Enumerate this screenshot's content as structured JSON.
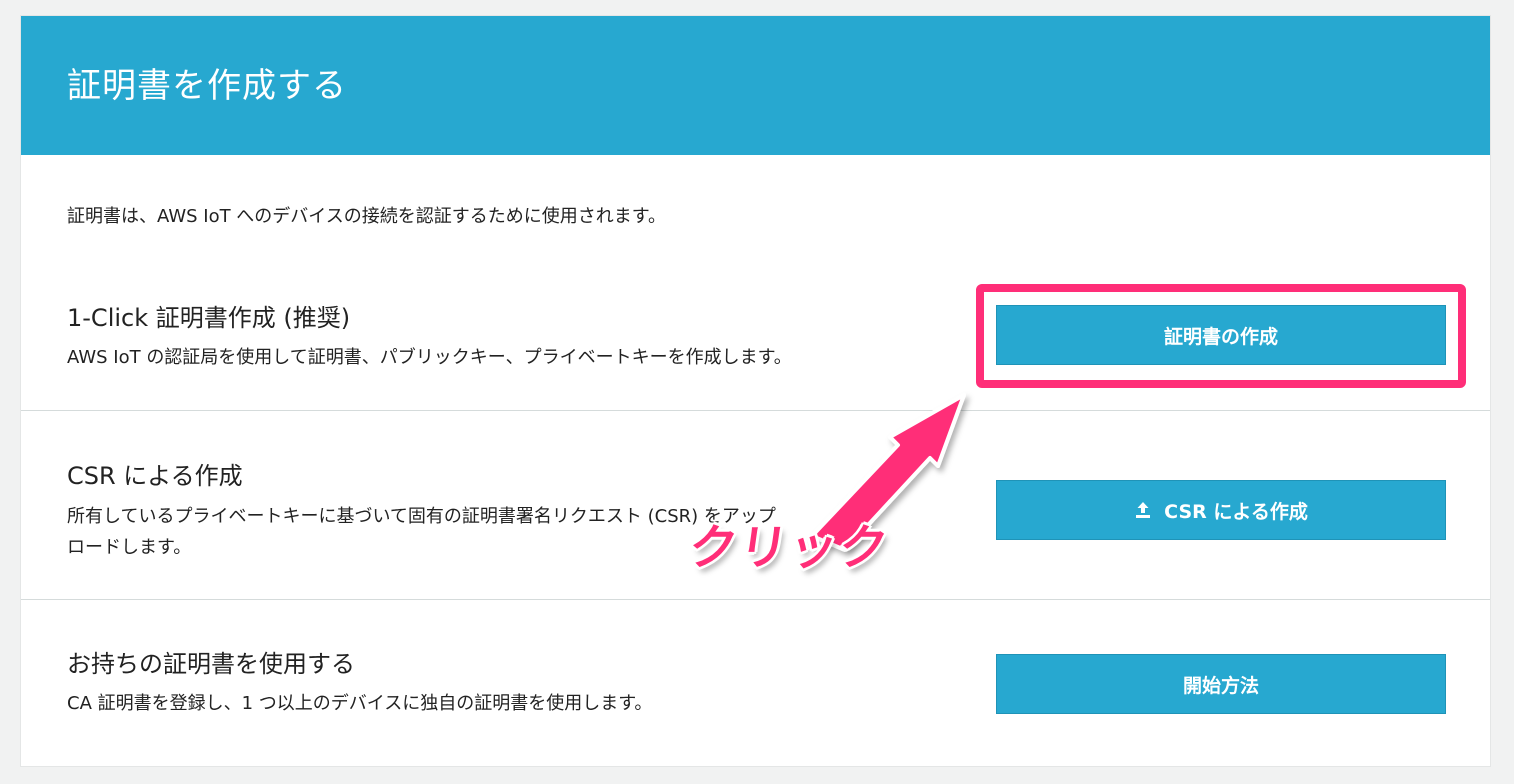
{
  "header": {
    "title": "証明書を作成する"
  },
  "intro": "証明書は、AWS IoT へのデバイスの接続を認証するために使用されます。",
  "sections": [
    {
      "title": "1-Click 証明書作成 (推奨)",
      "description": "AWS IoT の認証局を使用して証明書、パブリックキー、プライベートキーを作成します。",
      "button_label": "証明書の作成"
    },
    {
      "title": "CSR による作成",
      "description_line1": "所有しているプライベートキーに基づいて固有の証明書署名リクエスト (CSR) をアップ",
      "description_line2": "ロードします。",
      "button_label": "CSR による作成",
      "button_icon": "upload-icon"
    },
    {
      "title": "お持ちの証明書を使用する",
      "description": "CA 証明書を登録し、1 つ以上のデバイスに独自の証明書を使用します。",
      "button_label": "開始方法"
    }
  ],
  "annotation": {
    "text": "クリック",
    "color": "#ff2e78"
  },
  "colors": {
    "header_bg": "#27a8d0",
    "button_bg": "#27a8d0",
    "highlight": "#ff2e78"
  }
}
